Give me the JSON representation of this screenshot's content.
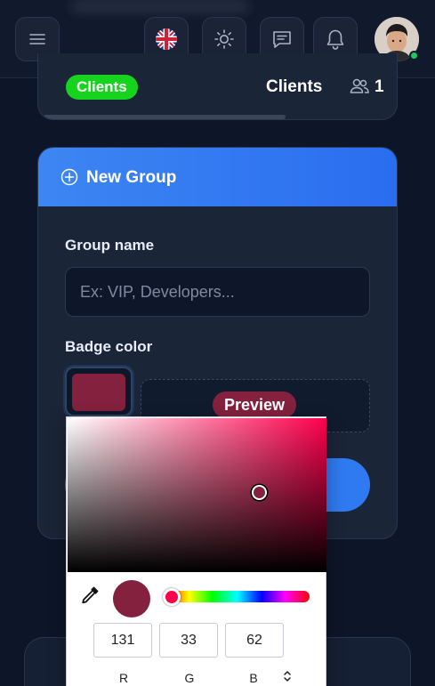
{
  "topbar": {
    "menu_icon": "hamburger-icon",
    "language_icon": "uk-flag-icon",
    "theme_icon": "sun-icon",
    "chat_icon": "chat-icon",
    "notification_icon": "bell-icon",
    "avatar_alt": "user-avatar",
    "status": "online"
  },
  "clients_card": {
    "badge_label": "Clients",
    "badge_color": "#16d41d",
    "title": "Clients",
    "members_icon": "users-icon",
    "member_count": "1"
  },
  "new_group": {
    "header_icon": "plus-circle-icon",
    "title": "New Group",
    "header_color": "#3d86f2",
    "name_label": "Group name",
    "name_value": "",
    "name_placeholder": "Ex: VIP, Developers...",
    "color_label": "Badge color",
    "badge_color": "#83213e",
    "preview_label": "Preview"
  },
  "color_picker": {
    "eyedropper_icon": "eyedropper-icon",
    "current_color": "#83213e",
    "r": "131",
    "g": "33",
    "b": "62",
    "r_label": "R",
    "g_label": "G",
    "b_label": "B",
    "mode_toggle_icon": "up-down-chevron-icon"
  }
}
